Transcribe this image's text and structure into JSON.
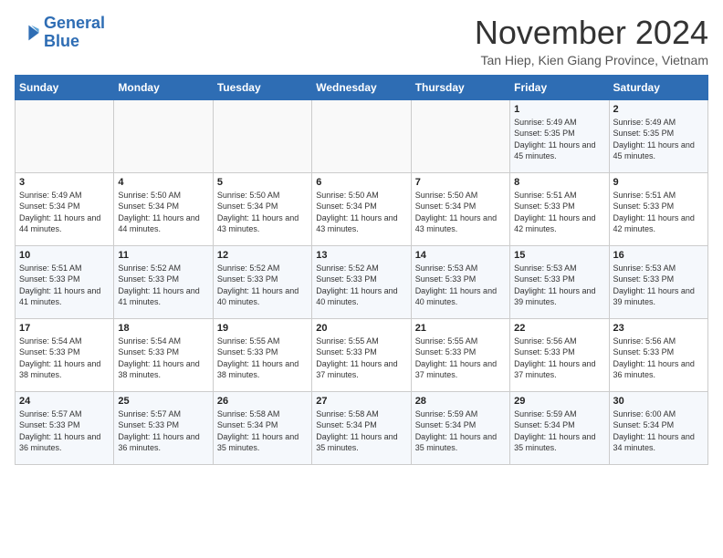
{
  "logo": {
    "line1": "General",
    "line2": "Blue"
  },
  "title": "November 2024",
  "location": "Tan Hiep, Kien Giang Province, Vietnam",
  "days_of_week": [
    "Sunday",
    "Monday",
    "Tuesday",
    "Wednesday",
    "Thursday",
    "Friday",
    "Saturday"
  ],
  "weeks": [
    [
      {
        "day": "",
        "info": ""
      },
      {
        "day": "",
        "info": ""
      },
      {
        "day": "",
        "info": ""
      },
      {
        "day": "",
        "info": ""
      },
      {
        "day": "",
        "info": ""
      },
      {
        "day": "1",
        "info": "Sunrise: 5:49 AM\nSunset: 5:35 PM\nDaylight: 11 hours and 45 minutes."
      },
      {
        "day": "2",
        "info": "Sunrise: 5:49 AM\nSunset: 5:35 PM\nDaylight: 11 hours and 45 minutes."
      }
    ],
    [
      {
        "day": "3",
        "info": "Sunrise: 5:49 AM\nSunset: 5:34 PM\nDaylight: 11 hours and 44 minutes."
      },
      {
        "day": "4",
        "info": "Sunrise: 5:50 AM\nSunset: 5:34 PM\nDaylight: 11 hours and 44 minutes."
      },
      {
        "day": "5",
        "info": "Sunrise: 5:50 AM\nSunset: 5:34 PM\nDaylight: 11 hours and 43 minutes."
      },
      {
        "day": "6",
        "info": "Sunrise: 5:50 AM\nSunset: 5:34 PM\nDaylight: 11 hours and 43 minutes."
      },
      {
        "day": "7",
        "info": "Sunrise: 5:50 AM\nSunset: 5:34 PM\nDaylight: 11 hours and 43 minutes."
      },
      {
        "day": "8",
        "info": "Sunrise: 5:51 AM\nSunset: 5:33 PM\nDaylight: 11 hours and 42 minutes."
      },
      {
        "day": "9",
        "info": "Sunrise: 5:51 AM\nSunset: 5:33 PM\nDaylight: 11 hours and 42 minutes."
      }
    ],
    [
      {
        "day": "10",
        "info": "Sunrise: 5:51 AM\nSunset: 5:33 PM\nDaylight: 11 hours and 41 minutes."
      },
      {
        "day": "11",
        "info": "Sunrise: 5:52 AM\nSunset: 5:33 PM\nDaylight: 11 hours and 41 minutes."
      },
      {
        "day": "12",
        "info": "Sunrise: 5:52 AM\nSunset: 5:33 PM\nDaylight: 11 hours and 40 minutes."
      },
      {
        "day": "13",
        "info": "Sunrise: 5:52 AM\nSunset: 5:33 PM\nDaylight: 11 hours and 40 minutes."
      },
      {
        "day": "14",
        "info": "Sunrise: 5:53 AM\nSunset: 5:33 PM\nDaylight: 11 hours and 40 minutes."
      },
      {
        "day": "15",
        "info": "Sunrise: 5:53 AM\nSunset: 5:33 PM\nDaylight: 11 hours and 39 minutes."
      },
      {
        "day": "16",
        "info": "Sunrise: 5:53 AM\nSunset: 5:33 PM\nDaylight: 11 hours and 39 minutes."
      }
    ],
    [
      {
        "day": "17",
        "info": "Sunrise: 5:54 AM\nSunset: 5:33 PM\nDaylight: 11 hours and 38 minutes."
      },
      {
        "day": "18",
        "info": "Sunrise: 5:54 AM\nSunset: 5:33 PM\nDaylight: 11 hours and 38 minutes."
      },
      {
        "day": "19",
        "info": "Sunrise: 5:55 AM\nSunset: 5:33 PM\nDaylight: 11 hours and 38 minutes."
      },
      {
        "day": "20",
        "info": "Sunrise: 5:55 AM\nSunset: 5:33 PM\nDaylight: 11 hours and 37 minutes."
      },
      {
        "day": "21",
        "info": "Sunrise: 5:55 AM\nSunset: 5:33 PM\nDaylight: 11 hours and 37 minutes."
      },
      {
        "day": "22",
        "info": "Sunrise: 5:56 AM\nSunset: 5:33 PM\nDaylight: 11 hours and 37 minutes."
      },
      {
        "day": "23",
        "info": "Sunrise: 5:56 AM\nSunset: 5:33 PM\nDaylight: 11 hours and 36 minutes."
      }
    ],
    [
      {
        "day": "24",
        "info": "Sunrise: 5:57 AM\nSunset: 5:33 PM\nDaylight: 11 hours and 36 minutes."
      },
      {
        "day": "25",
        "info": "Sunrise: 5:57 AM\nSunset: 5:33 PM\nDaylight: 11 hours and 36 minutes."
      },
      {
        "day": "26",
        "info": "Sunrise: 5:58 AM\nSunset: 5:34 PM\nDaylight: 11 hours and 35 minutes."
      },
      {
        "day": "27",
        "info": "Sunrise: 5:58 AM\nSunset: 5:34 PM\nDaylight: 11 hours and 35 minutes."
      },
      {
        "day": "28",
        "info": "Sunrise: 5:59 AM\nSunset: 5:34 PM\nDaylight: 11 hours and 35 minutes."
      },
      {
        "day": "29",
        "info": "Sunrise: 5:59 AM\nSunset: 5:34 PM\nDaylight: 11 hours and 35 minutes."
      },
      {
        "day": "30",
        "info": "Sunrise: 6:00 AM\nSunset: 5:34 PM\nDaylight: 11 hours and 34 minutes."
      }
    ]
  ]
}
